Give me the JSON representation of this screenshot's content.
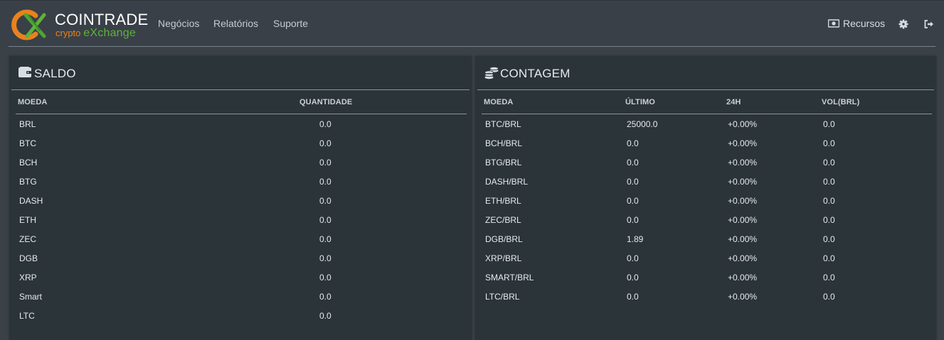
{
  "brand": {
    "name": "COINTRADE",
    "tagline_part1": "crypto",
    "tagline_part2": "eXchange",
    "colors": {
      "orange": "#e8821e",
      "green": "#5db33a"
    }
  },
  "nav": {
    "items": [
      {
        "label": "Negócios"
      },
      {
        "label": "Relatórios"
      },
      {
        "label": "Suporte"
      }
    ],
    "recursos_label": "Recursos",
    "icons": {
      "recursos": "money-icon",
      "settings": "gear-icon",
      "logout": "sign-out-icon"
    }
  },
  "saldo": {
    "title": "SALDO",
    "icon": "wallet-icon",
    "columns": [
      "MOEDA",
      "QUANTIDADE"
    ],
    "rows": [
      {
        "coin": "BRL",
        "qty": "0.0"
      },
      {
        "coin": "BTC",
        "qty": "0.0"
      },
      {
        "coin": "BCH",
        "qty": "0.0"
      },
      {
        "coin": "BTG",
        "qty": "0.0"
      },
      {
        "coin": "DASH",
        "qty": "0.0"
      },
      {
        "coin": "ETH",
        "qty": "0.0"
      },
      {
        "coin": "ZEC",
        "qty": "0.0"
      },
      {
        "coin": "DGB",
        "qty": "0.0"
      },
      {
        "coin": "XRP",
        "qty": "0.0"
      },
      {
        "coin": "Smart",
        "qty": "0.0"
      },
      {
        "coin": "LTC",
        "qty": "0.0"
      }
    ]
  },
  "contagem": {
    "title": "CONTAGEM",
    "icon": "coins-icon",
    "columns": [
      "MOEDA",
      "ÚLTIMO",
      "24H",
      "VOL(BRL)"
    ],
    "rows": [
      {
        "pair": "BTC/BRL",
        "last": "25000.0",
        "change": "+0.00%",
        "vol": "0.0"
      },
      {
        "pair": "BCH/BRL",
        "last": "0.0",
        "change": "+0.00%",
        "vol": "0.0"
      },
      {
        "pair": "BTG/BRL",
        "last": "0.0",
        "change": "+0.00%",
        "vol": "0.0"
      },
      {
        "pair": "DASH/BRL",
        "last": "0.0",
        "change": "+0.00%",
        "vol": "0.0"
      },
      {
        "pair": "ETH/BRL",
        "last": "0.0",
        "change": "+0.00%",
        "vol": "0.0"
      },
      {
        "pair": "ZEC/BRL",
        "last": "0.0",
        "change": "+0.00%",
        "vol": "0.0"
      },
      {
        "pair": "DGB/BRL",
        "last": "1.89",
        "change": "+0.00%",
        "vol": "0.0"
      },
      {
        "pair": "XRP/BRL",
        "last": "0.0",
        "change": "+0.00%",
        "vol": "0.0"
      },
      {
        "pair": "SMART/BRL",
        "last": "0.0",
        "change": "+0.00%",
        "vol": "0.0"
      },
      {
        "pair": "LTC/BRL",
        "last": "0.0",
        "change": "+0.00%",
        "vol": "0.0"
      }
    ]
  }
}
